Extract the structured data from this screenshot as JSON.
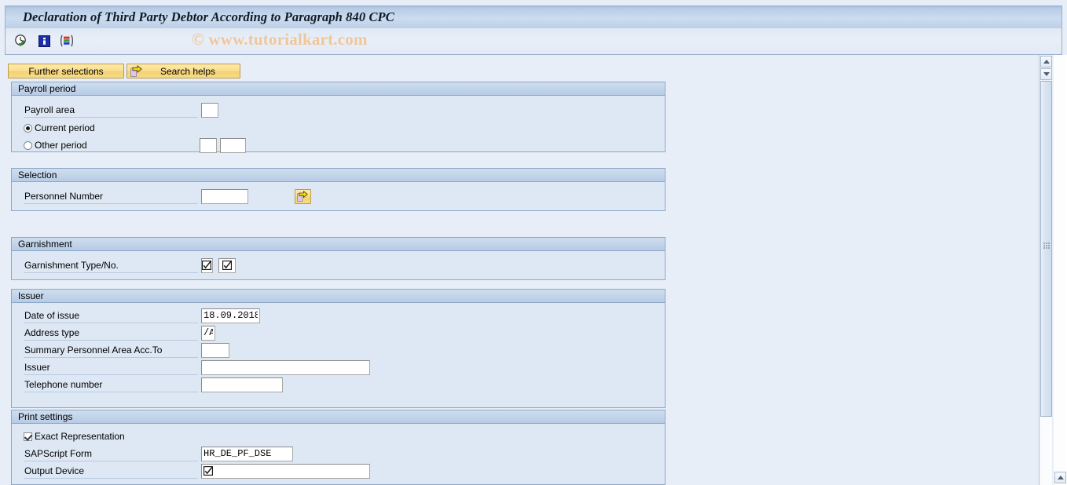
{
  "window": {
    "title": "Declaration of Third Party Debtor According to Paragraph 840 CPC",
    "watermark": "© www.tutorialkart.com"
  },
  "toolbar": {
    "icons": [
      {
        "name": "execute-clock-icon",
        "label": "Execute"
      },
      {
        "name": "information-icon",
        "label": "Information"
      },
      {
        "name": "variant-list-icon",
        "label": "Get Variant"
      }
    ]
  },
  "buttons": {
    "further_selections": "Further selections",
    "search_helps": "Search helps"
  },
  "groups": {
    "payroll_period": {
      "title": "Payroll period",
      "payroll_area_label": "Payroll area",
      "payroll_area_value": "",
      "current_period_label": "Current period",
      "current_period_selected": true,
      "other_period_label": "Other period",
      "other_period_selected": false,
      "other_period_value_1": "",
      "other_period_value_2": ""
    },
    "selection": {
      "title": "Selection",
      "personnel_number_label": "Personnel Number",
      "personnel_number_value": "",
      "multiple_selection_icon": "multiple-selection-arrow-icon"
    },
    "garnishment": {
      "title": "Garnishment",
      "type_no_label": "Garnishment Type/No.",
      "type_value": "",
      "no_value": ""
    },
    "issuer": {
      "title": "Issuer",
      "rows": [
        {
          "label": "Date of issue",
          "value": "18.09.2018"
        },
        {
          "label": "Address type",
          "value": "/A"
        },
        {
          "label": "Summary Personnel Area Acc.To",
          "value": ""
        },
        {
          "label": "Issuer",
          "value": ""
        },
        {
          "label": "Telephone number",
          "value": ""
        }
      ]
    },
    "print_settings": {
      "title": "Print settings",
      "exact_representation_label": "Exact Representation",
      "exact_representation_checked": true,
      "sapscript_form_label": "SAPScript Form",
      "sapscript_form_value": "HR_DE_PF_DSE",
      "output_device_label": "Output Device",
      "output_device_value": ""
    }
  },
  "scrollbar": {
    "up_arrow": "scroll-up-arrow",
    "down_arrow": "scroll-down-arrow"
  },
  "colors": {
    "title_bar": "#bdd0e8",
    "canvas": "#e8eef7",
    "group_body": "#dee8f4",
    "group_header": "#c2d4ea",
    "button_yellow": "#f8da84",
    "watermark": "#f0c392",
    "border": "#8da7c6"
  }
}
